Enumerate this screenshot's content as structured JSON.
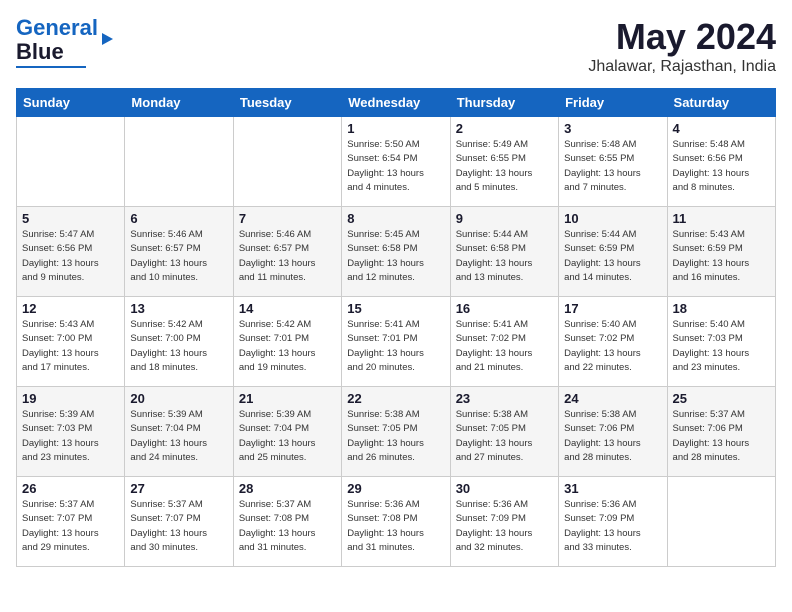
{
  "header": {
    "logo_line1": "General",
    "logo_line2": "Blue",
    "month": "May 2024",
    "location": "Jhalawar, Rajasthan, India"
  },
  "days_of_week": [
    "Sunday",
    "Monday",
    "Tuesday",
    "Wednesday",
    "Thursday",
    "Friday",
    "Saturday"
  ],
  "weeks": [
    [
      {
        "day": "",
        "info": ""
      },
      {
        "day": "",
        "info": ""
      },
      {
        "day": "",
        "info": ""
      },
      {
        "day": "1",
        "info": "Sunrise: 5:50 AM\nSunset: 6:54 PM\nDaylight: 13 hours\nand 4 minutes."
      },
      {
        "day": "2",
        "info": "Sunrise: 5:49 AM\nSunset: 6:55 PM\nDaylight: 13 hours\nand 5 minutes."
      },
      {
        "day": "3",
        "info": "Sunrise: 5:48 AM\nSunset: 6:55 PM\nDaylight: 13 hours\nand 7 minutes."
      },
      {
        "day": "4",
        "info": "Sunrise: 5:48 AM\nSunset: 6:56 PM\nDaylight: 13 hours\nand 8 minutes."
      }
    ],
    [
      {
        "day": "5",
        "info": "Sunrise: 5:47 AM\nSunset: 6:56 PM\nDaylight: 13 hours\nand 9 minutes."
      },
      {
        "day": "6",
        "info": "Sunrise: 5:46 AM\nSunset: 6:57 PM\nDaylight: 13 hours\nand 10 minutes."
      },
      {
        "day": "7",
        "info": "Sunrise: 5:46 AM\nSunset: 6:57 PM\nDaylight: 13 hours\nand 11 minutes."
      },
      {
        "day": "8",
        "info": "Sunrise: 5:45 AM\nSunset: 6:58 PM\nDaylight: 13 hours\nand 12 minutes."
      },
      {
        "day": "9",
        "info": "Sunrise: 5:44 AM\nSunset: 6:58 PM\nDaylight: 13 hours\nand 13 minutes."
      },
      {
        "day": "10",
        "info": "Sunrise: 5:44 AM\nSunset: 6:59 PM\nDaylight: 13 hours\nand 14 minutes."
      },
      {
        "day": "11",
        "info": "Sunrise: 5:43 AM\nSunset: 6:59 PM\nDaylight: 13 hours\nand 16 minutes."
      }
    ],
    [
      {
        "day": "12",
        "info": "Sunrise: 5:43 AM\nSunset: 7:00 PM\nDaylight: 13 hours\nand 17 minutes."
      },
      {
        "day": "13",
        "info": "Sunrise: 5:42 AM\nSunset: 7:00 PM\nDaylight: 13 hours\nand 18 minutes."
      },
      {
        "day": "14",
        "info": "Sunrise: 5:42 AM\nSunset: 7:01 PM\nDaylight: 13 hours\nand 19 minutes."
      },
      {
        "day": "15",
        "info": "Sunrise: 5:41 AM\nSunset: 7:01 PM\nDaylight: 13 hours\nand 20 minutes."
      },
      {
        "day": "16",
        "info": "Sunrise: 5:41 AM\nSunset: 7:02 PM\nDaylight: 13 hours\nand 21 minutes."
      },
      {
        "day": "17",
        "info": "Sunrise: 5:40 AM\nSunset: 7:02 PM\nDaylight: 13 hours\nand 22 minutes."
      },
      {
        "day": "18",
        "info": "Sunrise: 5:40 AM\nSunset: 7:03 PM\nDaylight: 13 hours\nand 23 minutes."
      }
    ],
    [
      {
        "day": "19",
        "info": "Sunrise: 5:39 AM\nSunset: 7:03 PM\nDaylight: 13 hours\nand 23 minutes."
      },
      {
        "day": "20",
        "info": "Sunrise: 5:39 AM\nSunset: 7:04 PM\nDaylight: 13 hours\nand 24 minutes."
      },
      {
        "day": "21",
        "info": "Sunrise: 5:39 AM\nSunset: 7:04 PM\nDaylight: 13 hours\nand 25 minutes."
      },
      {
        "day": "22",
        "info": "Sunrise: 5:38 AM\nSunset: 7:05 PM\nDaylight: 13 hours\nand 26 minutes."
      },
      {
        "day": "23",
        "info": "Sunrise: 5:38 AM\nSunset: 7:05 PM\nDaylight: 13 hours\nand 27 minutes."
      },
      {
        "day": "24",
        "info": "Sunrise: 5:38 AM\nSunset: 7:06 PM\nDaylight: 13 hours\nand 28 minutes."
      },
      {
        "day": "25",
        "info": "Sunrise: 5:37 AM\nSunset: 7:06 PM\nDaylight: 13 hours\nand 28 minutes."
      }
    ],
    [
      {
        "day": "26",
        "info": "Sunrise: 5:37 AM\nSunset: 7:07 PM\nDaylight: 13 hours\nand 29 minutes."
      },
      {
        "day": "27",
        "info": "Sunrise: 5:37 AM\nSunset: 7:07 PM\nDaylight: 13 hours\nand 30 minutes."
      },
      {
        "day": "28",
        "info": "Sunrise: 5:37 AM\nSunset: 7:08 PM\nDaylight: 13 hours\nand 31 minutes."
      },
      {
        "day": "29",
        "info": "Sunrise: 5:36 AM\nSunset: 7:08 PM\nDaylight: 13 hours\nand 31 minutes."
      },
      {
        "day": "30",
        "info": "Sunrise: 5:36 AM\nSunset: 7:09 PM\nDaylight: 13 hours\nand 32 minutes."
      },
      {
        "day": "31",
        "info": "Sunrise: 5:36 AM\nSunset: 7:09 PM\nDaylight: 13 hours\nand 33 minutes."
      },
      {
        "day": "",
        "info": ""
      }
    ]
  ]
}
